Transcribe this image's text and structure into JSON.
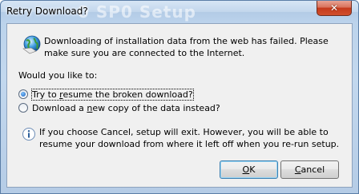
{
  "window": {
    "title": "Retry Download?",
    "background_title_fragment": "0 SP0 Setup",
    "close_glyph": "✕"
  },
  "message": {
    "text": "Downloading of installation data from the web has failed. Please make sure you are connected to the Internet.",
    "icon": "globe-info-icon"
  },
  "prompt": "Would you like to:",
  "options": [
    {
      "label_pre": "Try to ",
      "label_accel": "r",
      "label_post": "esume the broken download?",
      "selected": true
    },
    {
      "label_pre": "Download a ",
      "label_accel": "n",
      "label_post": "ew copy of the data instead?",
      "selected": false
    }
  ],
  "note": {
    "text": "If you choose Cancel, setup will exit. However, you will be able to resume your download from where it left off when you re-run setup.",
    "icon": "info-icon"
  },
  "buttons": {
    "ok": {
      "accel": "O",
      "rest": "K"
    },
    "cancel": {
      "accel": "C",
      "rest": "ancel"
    }
  },
  "colors": {
    "accent": "#3c7fb1",
    "close_red": "#c53a1c"
  }
}
